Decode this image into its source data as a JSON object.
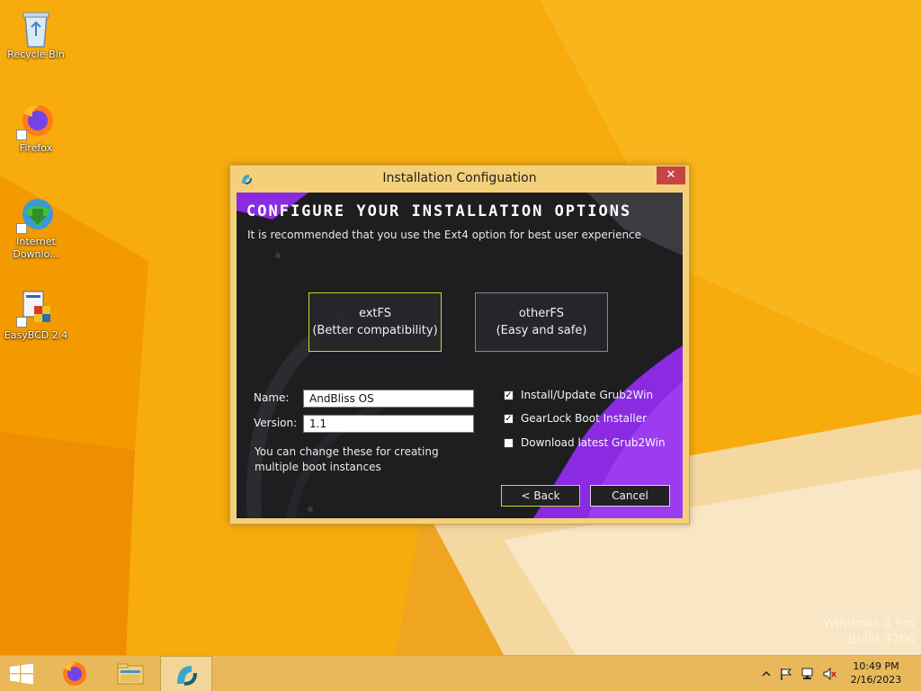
{
  "desktop": {
    "icons": [
      {
        "label": "Recycle Bin",
        "icon": "recycle-bin-icon"
      },
      {
        "label": "Firefox",
        "icon": "firefox-icon"
      },
      {
        "label": "Internet Downlo...",
        "icon": "internet-download-manager-icon"
      },
      {
        "label": "EasyBCD 2.4",
        "icon": "easybcd-icon"
      }
    ],
    "watermark": {
      "line1": "Windows 8 Pro",
      "line2": "Build 9200"
    }
  },
  "dialog": {
    "title": "Installation Configuation",
    "close_label": "✕",
    "heading": "CONFIGURE YOUR INSTALLATION OPTIONS",
    "subheading": "It is recommended that you use the Ext4 option for best user experience",
    "options": [
      {
        "title": "extFS",
        "subtitle": "(Better compatibility)",
        "selected": true
      },
      {
        "title": "otherFS",
        "subtitle": "(Easy and safe)",
        "selected": false
      }
    ],
    "name_label": "Name:",
    "name_value": "AndBliss OS",
    "version_label": "Version:",
    "version_value": "1.1",
    "hint": "You can change these for creating multiple boot instances",
    "checkboxes": [
      {
        "label": "Install/Update Grub2Win",
        "checked": true
      },
      {
        "label": "GearLock Boot Installer",
        "checked": true
      },
      {
        "label": "Download latest Grub2Win",
        "checked": false
      }
    ],
    "back_label": "< Back",
    "cancel_label": "Cancel"
  },
  "taskbar": {
    "items": [
      {
        "icon": "firefox-icon",
        "active": false
      },
      {
        "icon": "file-explorer-icon",
        "active": false
      },
      {
        "icon": "installer-app-icon",
        "active": true
      }
    ],
    "tray": {
      "icons": [
        "show-hidden-icons-chevron",
        "action-center-flag-icon",
        "network-icon",
        "volume-muted-icon"
      ],
      "time": "10:49 PM",
      "date": "2/16/2023"
    }
  },
  "colors": {
    "wallpaper": "#f5a800",
    "dialog_frame": "#f4d07a",
    "client_bg": "#1d1d1f",
    "accent_purple": "#8a2be2",
    "accent_yellow_green": "#c8d82a",
    "close_red": "#c74444"
  }
}
